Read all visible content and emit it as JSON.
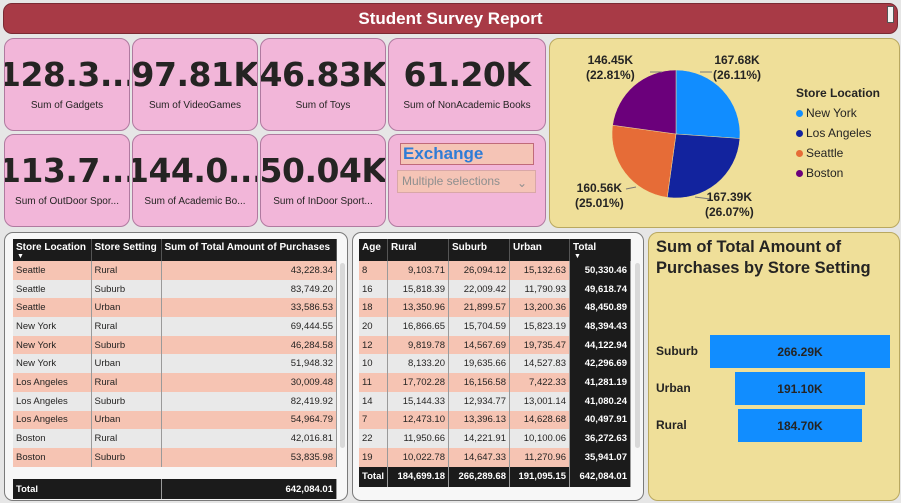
{
  "title": "Student Survey Report",
  "cards": [
    {
      "value": "128.3...",
      "label": "Sum of Gadgets"
    },
    {
      "value": "97.81K",
      "label": "Sum of VideoGames"
    },
    {
      "value": "46.83K",
      "label": "Sum of Toys"
    },
    {
      "value": "61.20K",
      "label": "Sum of NonAcademic Books"
    },
    {
      "value": "113.7...",
      "label": "Sum of OutDoor Spor..."
    },
    {
      "value": "144.0...",
      "label": "Sum of Academic Bo..."
    },
    {
      "value": "50.04K",
      "label": "Sum of InDoor Sport..."
    }
  ],
  "slicer": {
    "title": "Exchange",
    "value": "Multiple selections",
    "chevron_icon": "chevron-down-icon"
  },
  "pie": {
    "legend_title": "Store Location",
    "slices": [
      {
        "name": "New York",
        "value_label": "167.68K",
        "pct_label": "(26.11%)",
        "value": 167.68,
        "color": "#118dff"
      },
      {
        "name": "Los Angeles",
        "value_label": "167.39K",
        "pct_label": "(26.07%)",
        "value": 167.39,
        "color": "#12239e"
      },
      {
        "name": "Seattle",
        "value_label": "160.56K",
        "pct_label": "(25.01%)",
        "value": 160.56,
        "color": "#e66c37"
      },
      {
        "name": "Boston",
        "value_label": "146.45K",
        "pct_label": "(22.81%)",
        "value": 146.45,
        "color": "#6b007b"
      }
    ]
  },
  "table1": {
    "headers": [
      "Store Location",
      "Store Setting",
      "Sum of Total Amount of Purchases"
    ],
    "rows": [
      [
        "Seattle",
        "Rural",
        "43,228.34"
      ],
      [
        "Seattle",
        "Suburb",
        "83,749.20"
      ],
      [
        "Seattle",
        "Urban",
        "33,586.53"
      ],
      [
        "New York",
        "Rural",
        "69,444.55"
      ],
      [
        "New York",
        "Suburb",
        "46,284.58"
      ],
      [
        "New York",
        "Urban",
        "51,948.32"
      ],
      [
        "Los Angeles",
        "Rural",
        "30,009.48"
      ],
      [
        "Los Angeles",
        "Suburb",
        "82,419.92"
      ],
      [
        "Los Angeles",
        "Urban",
        "54,964.79"
      ],
      [
        "Boston",
        "Rural",
        "42,016.81"
      ],
      [
        "Boston",
        "Suburb",
        "53,835.98"
      ]
    ],
    "total_label": "Total",
    "total_value": "642,084.01"
  },
  "table2": {
    "headers": [
      "Age",
      "Rural",
      "Suburb",
      "Urban",
      "Total"
    ],
    "rows": [
      [
        "8",
        "9,103.71",
        "26,094.12",
        "15,132.63",
        "50,330.46"
      ],
      [
        "16",
        "15,818.39",
        "22,009.42",
        "11,790.93",
        "49,618.74"
      ],
      [
        "18",
        "13,350.96",
        "21,899.57",
        "13,200.36",
        "48,450.89"
      ],
      [
        "20",
        "16,866.65",
        "15,704.59",
        "15,823.19",
        "48,394.43"
      ],
      [
        "12",
        "9,819.78",
        "14,567.69",
        "19,735.47",
        "44,122.94"
      ],
      [
        "10",
        "8,133.20",
        "19,635.66",
        "14,527.83",
        "42,296.69"
      ],
      [
        "11",
        "17,702.28",
        "16,156.58",
        "7,422.33",
        "41,281.19"
      ],
      [
        "14",
        "15,144.33",
        "12,934.77",
        "13,001.14",
        "41,080.24"
      ],
      [
        "7",
        "12,473.10",
        "13,396.13",
        "14,628.68",
        "40,497.91"
      ],
      [
        "22",
        "11,950.66",
        "14,221.91",
        "10,100.06",
        "36,272.63"
      ],
      [
        "19",
        "10,022.78",
        "14,647.33",
        "11,270.96",
        "35,941.07"
      ]
    ],
    "total": [
      "Total",
      "184,699.18",
      "266,289.68",
      "191,095.15",
      "642,084.01"
    ]
  },
  "bar_chart": {
    "title_line1": "Sum of Total Amount of",
    "title_line2": "Purchases by Store Setting"
  },
  "chart_data": {
    "type": "bar",
    "orientation": "horizontal",
    "categories": [
      "Suburb",
      "Urban",
      "Rural"
    ],
    "values": [
      266.29,
      191.1,
      184.7
    ],
    "value_labels": [
      "266.29K",
      "191.10K",
      "184.70K"
    ],
    "unit": "K",
    "title": "Sum of Total Amount of Purchases by Store Setting",
    "color": "#118dff"
  }
}
